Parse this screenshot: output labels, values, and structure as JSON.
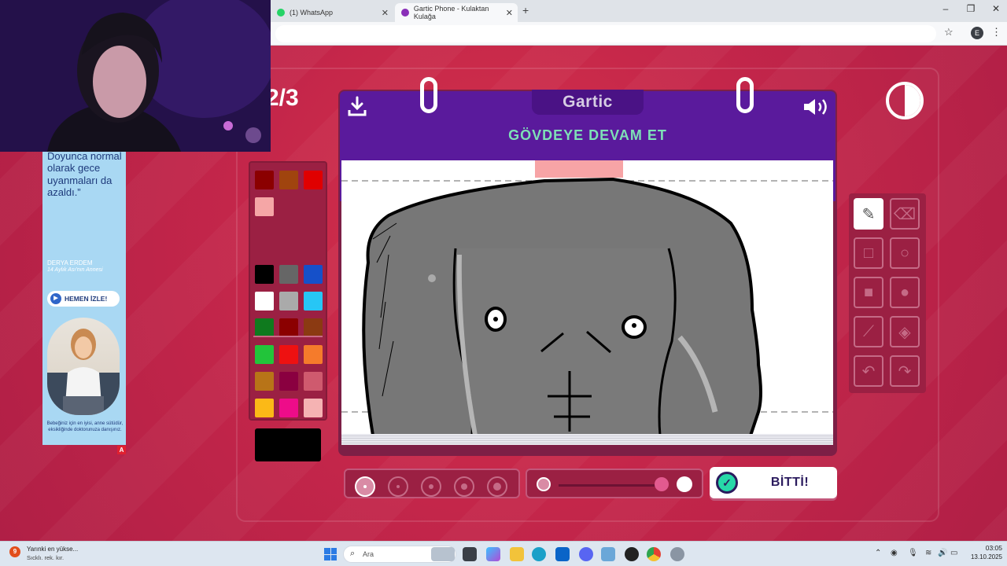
{
  "browser": {
    "tabs": [
      {
        "label": "(1) WhatsApp",
        "active": false
      },
      {
        "label": "Gartic Phone - Kulaktan Kulağa",
        "active": true
      }
    ]
  },
  "game": {
    "round": "2/3",
    "logo": "Gartic",
    "prompt": "GÖVDEYE DEVAM ET",
    "done_label": "BİTTİ!",
    "palette": [
      "#8b0000",
      "#a0440e",
      "#e00000",
      "#f5a6a6",
      "#000000",
      "#666666",
      "#1550c9",
      "#ffffff",
      "#aaaaaa",
      "#27c6f5",
      "#0f7a1e",
      "#8b0000",
      "#8b3a12",
      "#22c43a",
      "#ee1111",
      "#f57b2b",
      "#b87418",
      "#8a0040",
      "#cf5a6e",
      "#fbb917",
      "#ee0c89",
      "#f5b3b3"
    ],
    "current_color": "#000000",
    "tools": [
      "pencil-icon",
      "eraser-icon",
      "square-outline-icon",
      "circle-outline-icon",
      "square-filled-icon",
      "circle-filled-icon",
      "line-icon",
      "fill-bucket-icon",
      "undo-icon",
      "redo-icon"
    ],
    "selected_tool": "pencil-icon",
    "selected_size_index": 0
  },
  "ad": {
    "quote": "“Mal'ın keyifle devam sütünü içiyordu. Doyunca normal olarak gece uyanmaları da azaldı.”",
    "author": "DERYA ERDEM",
    "author_sub": "14 Aylık Ası'nın Annesi",
    "button": "HEMEN İZLE!",
    "footnote": "Bebeğiniz için en iyisi, anne sütüdür, eksikliğinde doktorunuza danışınız.",
    "badge": "A"
  },
  "taskbar": {
    "weather_badge": "9",
    "weather_title": "Yarınki en yükse...",
    "weather_sub": "Sıcklı. rek. kır.",
    "search_placeholder": "Ara",
    "time": "03:05",
    "date": "13.10.2025"
  }
}
